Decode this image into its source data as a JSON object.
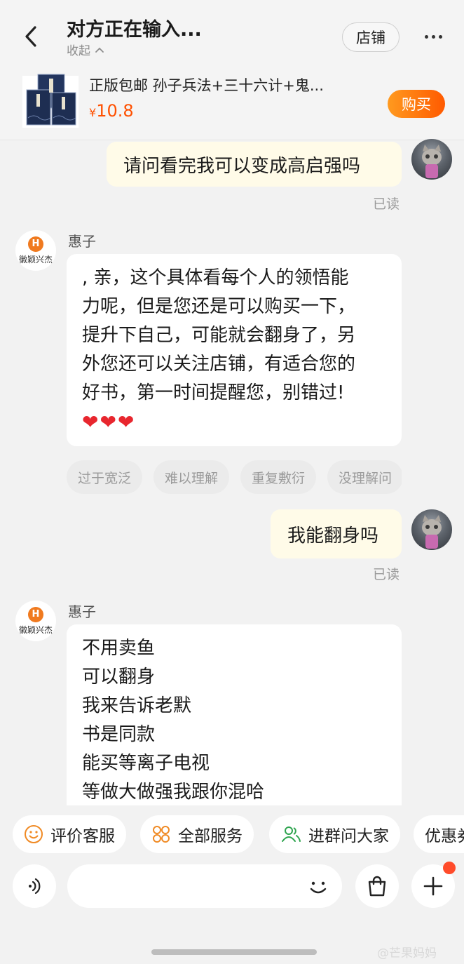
{
  "header": {
    "title": "对方正在输入...",
    "collapse_label": "收起",
    "shop_button": "店铺"
  },
  "product": {
    "name": "正版包邮 孙子兵法+三十六计+鬼...",
    "currency": "¥",
    "price": "10.8",
    "buy_button": "购买",
    "accent_color": "#ff5000"
  },
  "messages": [
    {
      "side": "right",
      "text": "请问看完我可以变成高启强吗",
      "status": "已读"
    },
    {
      "side": "left",
      "sender": "惠子",
      "avatar_text": "徽颖兴杰",
      "avatar_mark": "H",
      "lines": [
        ", 亲，这个具体看每个人的领悟能",
        "力呢，但是您还是可以购买一下，",
        "提升下自己，可能就会翻身了，另",
        "外您还可以关注店铺，有适合您的",
        "好书，第一时间提醒您，别错过!"
      ],
      "hearts": "❤❤❤"
    },
    {
      "side": "right",
      "text": "我能翻身吗",
      "status": "已读"
    },
    {
      "side": "left",
      "sender": "惠子",
      "avatar_text": "徽颖兴杰",
      "avatar_mark": "H",
      "lines": [
        "不用卖鱼",
        "可以翻身",
        "我来告诉老默",
        "书是同款",
        "能买等离子电视",
        "等做大做强我跟你混哈"
      ]
    }
  ],
  "feedback_chips": [
    "过于宽泛",
    "难以理解",
    "重复敷衍",
    "没理解问"
  ],
  "services": [
    {
      "label": "评价客服",
      "icon": "smile-icon"
    },
    {
      "label": "全部服务",
      "icon": "grid-icon"
    },
    {
      "label": "进群问大家",
      "icon": "group-icon"
    },
    {
      "label": "优惠券",
      "icon": ""
    }
  ],
  "input": {
    "placeholder": ""
  },
  "watermark": "@芒果妈妈"
}
